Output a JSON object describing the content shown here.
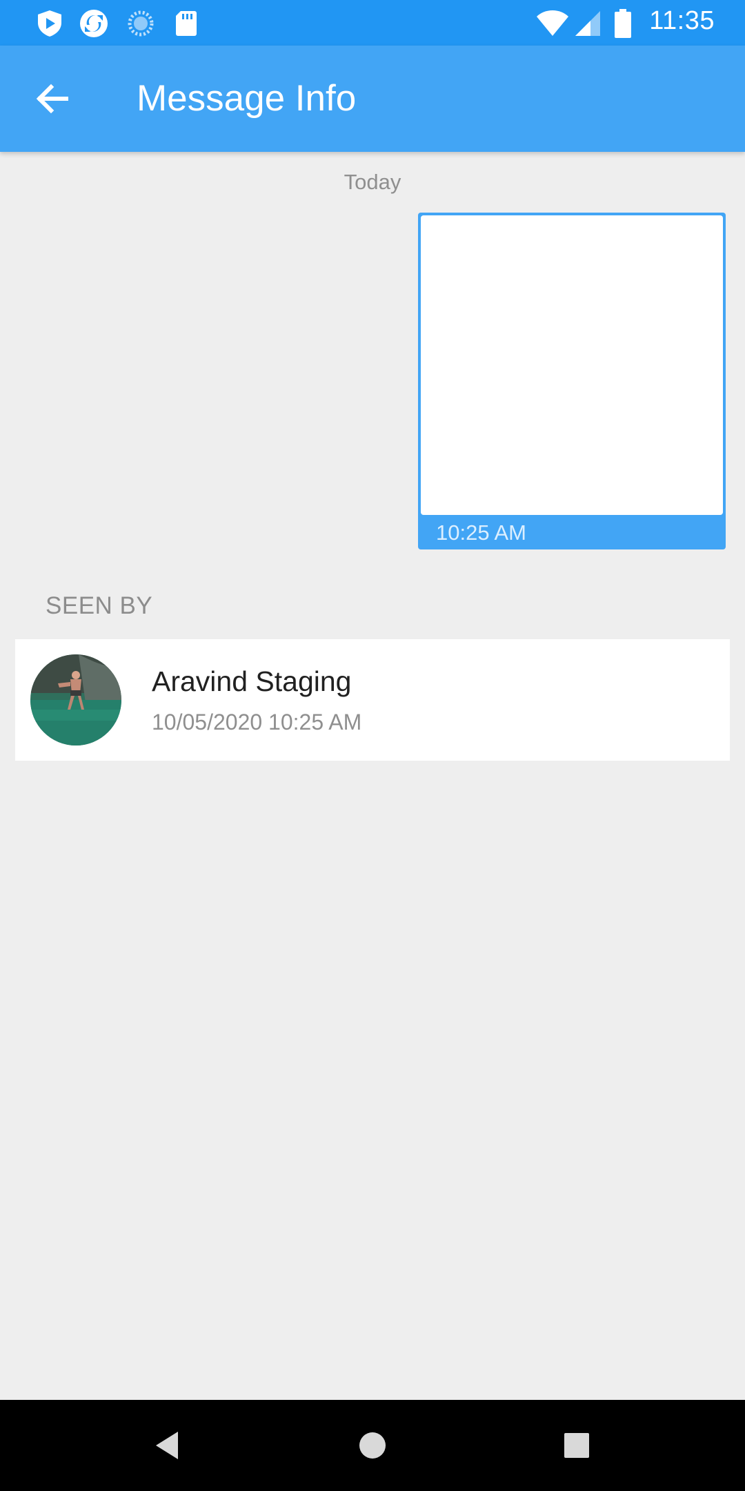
{
  "status_bar": {
    "time": "11:35",
    "left_icons": [
      "shield-icon",
      "sync-icon",
      "loading-icon",
      "sd-card-icon"
    ],
    "right_icons": [
      "wifi-icon",
      "signal-icon",
      "battery-icon"
    ],
    "color": "#2196f3"
  },
  "app_bar": {
    "title": "Message Info",
    "back_icon": "arrow-back-icon",
    "color": "#42a5f5"
  },
  "message": {
    "date_label": "Today",
    "time": "10:25 AM",
    "bubble_color": "#42a5f5"
  },
  "seen_by": {
    "label": "SEEN BY",
    "entries": [
      {
        "name": "Aravind Staging",
        "timestamp": "10/05/2020 10:25 AM",
        "avatar": "user-avatar"
      }
    ]
  },
  "nav_bar": {
    "buttons": [
      "back-triangle-icon",
      "home-circle-icon",
      "recents-square-icon"
    ]
  }
}
